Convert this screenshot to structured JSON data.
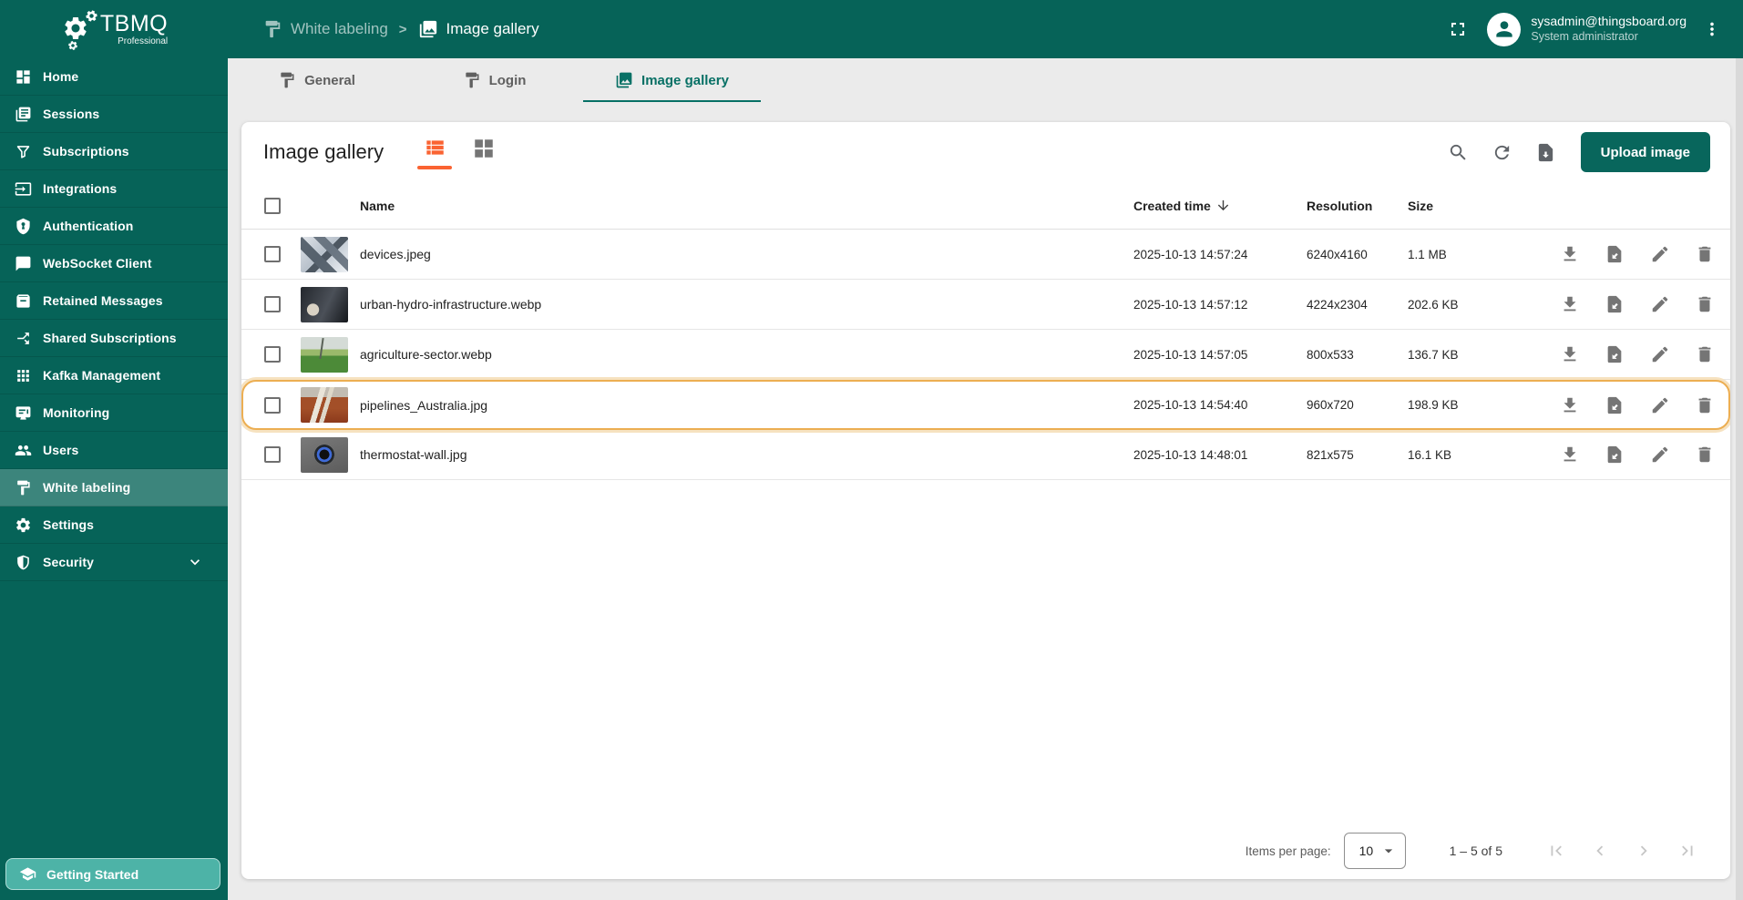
{
  "app": {
    "name": "TBMQ",
    "edition": "Professional"
  },
  "topbar": {
    "breadcrumb": [
      {
        "label": "White labeling",
        "icon": "paint-roller"
      },
      {
        "label": "Image gallery",
        "icon": "image-gallery"
      }
    ],
    "user": {
      "email": "sysadmin@thingsboard.org",
      "role": "System administrator"
    }
  },
  "sidebar": {
    "items": [
      {
        "label": "Home",
        "icon": "dashboard"
      },
      {
        "label": "Sessions",
        "icon": "sessions-book"
      },
      {
        "label": "Subscriptions",
        "icon": "filter"
      },
      {
        "label": "Integrations",
        "icon": "input"
      },
      {
        "label": "Authentication",
        "icon": "shield-lock"
      },
      {
        "label": "WebSocket Client",
        "icon": "chat"
      },
      {
        "label": "Retained Messages",
        "icon": "archive"
      },
      {
        "label": "Shared Subscriptions",
        "icon": "call-split"
      },
      {
        "label": "Kafka Management",
        "icon": "apps-grid"
      },
      {
        "label": "Monitoring",
        "icon": "monitor"
      },
      {
        "label": "Users",
        "icon": "people"
      },
      {
        "label": "White labeling",
        "icon": "paint-roller",
        "active": true
      },
      {
        "label": "Settings",
        "icon": "gear"
      },
      {
        "label": "Security",
        "icon": "shield-half",
        "expandable": true
      }
    ],
    "getting_started_label": "Getting Started"
  },
  "tabs": [
    {
      "label": "General",
      "icon": "paint-roller"
    },
    {
      "label": "Login",
      "icon": "paint-roller"
    },
    {
      "label": "Image gallery",
      "icon": "image-gallery",
      "active": true
    }
  ],
  "gallery": {
    "title": "Image gallery",
    "upload_button_label": "Upload image",
    "table": {
      "columns": [
        "Name",
        "Created time",
        "Resolution",
        "Size"
      ],
      "sort_column": "Created time",
      "sort_direction": "desc",
      "row_actions": [
        "download",
        "export",
        "edit",
        "delete"
      ],
      "rows": [
        {
          "name": "devices.jpeg",
          "created": "2025-10-13 14:57:24",
          "resolution": "6240x4160",
          "size": "1.1 MB",
          "thumb": "devices"
        },
        {
          "name": "urban-hydro-infrastructure.webp",
          "created": "2025-10-13 14:57:12",
          "resolution": "4224x2304",
          "size": "202.6 KB",
          "thumb": "hydro"
        },
        {
          "name": "agriculture-sector.webp",
          "created": "2025-10-13 14:57:05",
          "resolution": "800x533",
          "size": "136.7 KB",
          "thumb": "agriculture"
        },
        {
          "name": "pipelines_Australia.jpg",
          "created": "2025-10-13 14:54:40",
          "resolution": "960x720",
          "size": "198.9 KB",
          "thumb": "pipelines",
          "highlighted": true
        },
        {
          "name": "thermostat-wall.jpg",
          "created": "2025-10-13 14:48:01",
          "resolution": "821x575",
          "size": "16.1 KB",
          "thumb": "thermostat"
        }
      ]
    },
    "pagination": {
      "items_per_page_label": "Items per page:",
      "items_per_page_value": "10",
      "range_label": "1 – 5 of 5",
      "nav": [
        "first-page",
        "chevron-left",
        "chevron-right",
        "last-page"
      ]
    }
  },
  "colors": {
    "primary_teal": "#066358",
    "accent_orange": "#fa6332",
    "highlight_border": "#ecae52",
    "upload_button": "#08665c"
  }
}
